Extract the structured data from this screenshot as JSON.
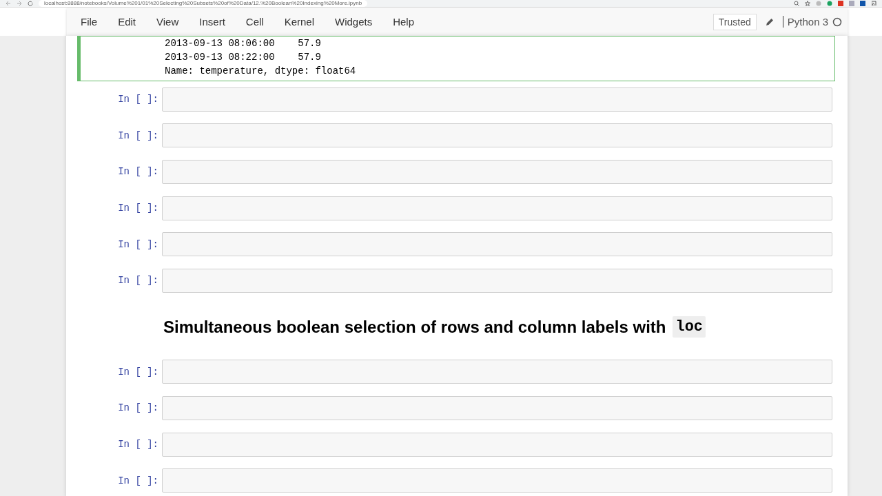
{
  "browser": {
    "url": "localhost:8888/notebooks/Volume%201/01%20Selecting%20Subsets%20of%20Data/12.%20Boolean%20Indexing%20More.ipynb"
  },
  "menu": [
    "File",
    "Edit",
    "View",
    "Insert",
    "Cell",
    "Kernel",
    "Widgets",
    "Help"
  ],
  "toolbar": {
    "trusted": "Trusted",
    "kernel": "Python 3",
    "kernel_busy": false
  },
  "cells": [
    {
      "kind": "output",
      "selected": true,
      "lines": [
        "2013-09-13 08:06:00    57.9",
        "2013-09-13 08:22:00    57.9",
        "Name: temperature, dtype: float64"
      ]
    },
    {
      "kind": "code",
      "selected": false,
      "prompt": "In [ ]:"
    },
    {
      "kind": "code",
      "selected": false,
      "prompt": "In [ ]:"
    },
    {
      "kind": "code",
      "selected": false,
      "prompt": "In [ ]:"
    },
    {
      "kind": "code",
      "selected": false,
      "prompt": "In [ ]:"
    },
    {
      "kind": "code",
      "selected": false,
      "prompt": "In [ ]:"
    },
    {
      "kind": "code",
      "selected": false,
      "prompt": "In [ ]:"
    },
    {
      "kind": "heading",
      "selected": false,
      "text": "Simultaneous boolean selection of rows and column labels with",
      "code": "loc"
    },
    {
      "kind": "code",
      "selected": false,
      "prompt": "In [ ]:"
    },
    {
      "kind": "code",
      "selected": false,
      "prompt": "In [ ]:"
    },
    {
      "kind": "code",
      "selected": false,
      "prompt": "In [ ]:"
    },
    {
      "kind": "code",
      "selected": false,
      "prompt": "In [ ]:"
    }
  ]
}
